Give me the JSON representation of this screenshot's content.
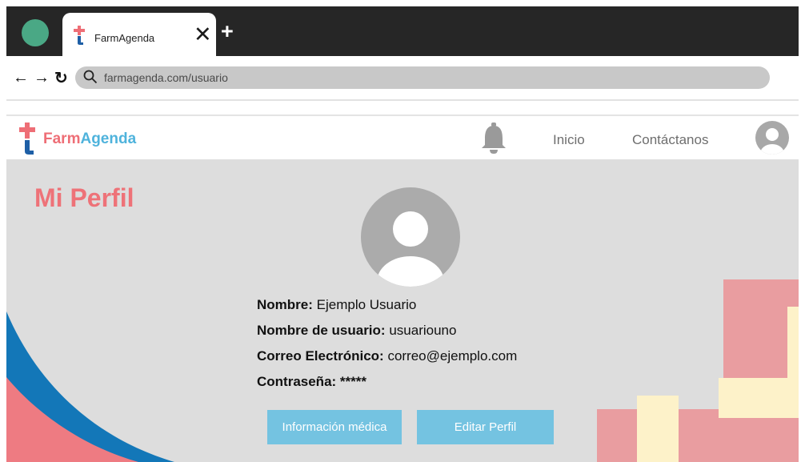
{
  "browser": {
    "tab_title": "FarmAgenda",
    "tab_close": "✕",
    "new_tab": "+",
    "back": "←",
    "forward": "→",
    "reload": "↻",
    "url": "farmagenda.com/usuario"
  },
  "header": {
    "logo_part1": "Farm",
    "logo_part2": "Agenda",
    "nav": {
      "home": "Inicio",
      "contact": "Contáctanos"
    },
    "icons": [
      "bell-icon",
      "user-avatar-icon"
    ]
  },
  "profile": {
    "title": "Mi Perfil",
    "fields": [
      {
        "label": "Nombre:",
        "value": "Ejemplo Usuario"
      },
      {
        "label": "Nombre de usuario:",
        "value": "usuariouno"
      },
      {
        "label": "Correo Electrónico:",
        "value": "correo@ejemplo.com"
      },
      {
        "label": "Contraseña:",
        "value": "*****"
      }
    ],
    "buttons": {
      "medical": "Información médica",
      "edit": "Editar Perfil"
    }
  },
  "colors": {
    "brand_red": "#ee6e76",
    "brand_blue": "#4fb3dc",
    "button_blue": "#74c3e1",
    "deco_blue": "#1377b8",
    "deco_pink": "#e99da0",
    "deco_cream": "#fdf2c9",
    "content_bg": "#dddddd"
  }
}
